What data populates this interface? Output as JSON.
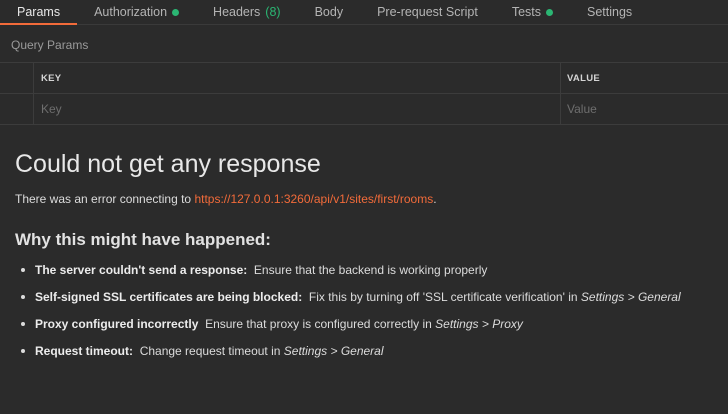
{
  "tabs": [
    {
      "label": "Params",
      "active": true
    },
    {
      "label": "Authorization",
      "dot": true
    },
    {
      "label": "Headers",
      "count": "(8)"
    },
    {
      "label": "Body"
    },
    {
      "label": "Pre-request Script"
    },
    {
      "label": "Tests",
      "dot": true
    },
    {
      "label": "Settings"
    }
  ],
  "query_params": {
    "title": "Query Params",
    "headers": {
      "key": "KEY",
      "value": "VALUE"
    },
    "placeholders": {
      "key": "Key",
      "value": "Value"
    }
  },
  "error": {
    "title": "Could not get any response",
    "line_prefix": "There was an error connecting to ",
    "url": "https://127.0.0.1:3260/api/v1/sites/first/rooms",
    "line_suffix": ".",
    "why_title": "Why this might have happened:",
    "reasons": [
      {
        "bold": "The server couldn't send a response:",
        "text": "Ensure that the backend is working properly",
        "italic": "",
        "tail": ""
      },
      {
        "bold": "Self-signed SSL certificates are being blocked:",
        "text": "Fix this by turning off 'SSL certificate verification' in ",
        "italic": "Settings > General",
        "tail": ""
      },
      {
        "bold": "Proxy configured incorrectly",
        "text": "Ensure that proxy is configured correctly in ",
        "italic": "Settings > Proxy",
        "tail": ""
      },
      {
        "bold": "Request timeout:",
        "text": "Change request timeout in ",
        "italic": "Settings > General",
        "tail": ""
      }
    ]
  },
  "colors": {
    "accent": "#f26b3a",
    "status_green": "#2bb673",
    "background": "#2b2b2b"
  }
}
